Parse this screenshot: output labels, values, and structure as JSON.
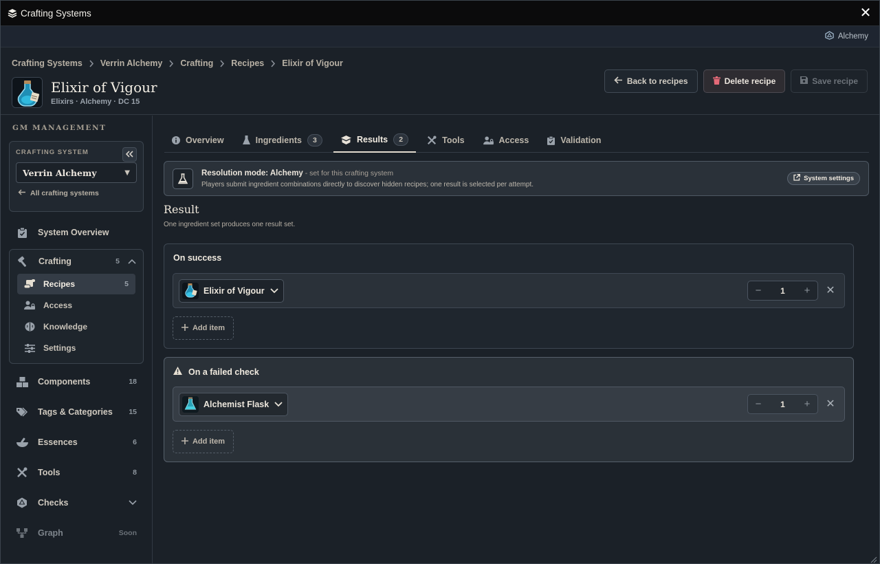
{
  "window": {
    "title": "Crafting Systems"
  },
  "sysbar": {
    "system_name": "Alchemy"
  },
  "breadcrumb": [
    "Crafting Systems",
    "Verrin Alchemy",
    "Crafting",
    "Recipes",
    "Elixir of Vigour"
  ],
  "recipe": {
    "title": "Elixir of Vigour",
    "meta": "Elixirs · Alchemy · DC 15"
  },
  "actions": {
    "back": "Back to recipes",
    "delete": "Delete recipe",
    "save": "Save recipe"
  },
  "sidebar": {
    "heading": "GM MANAGEMENT",
    "system_label": "CRAFTING SYSTEM",
    "system_selected": "Verrin Alchemy",
    "all_systems": "All crafting systems",
    "overview": "System Overview",
    "crafting": {
      "label": "Crafting",
      "count": "5"
    },
    "sub_items": [
      {
        "label": "Recipes",
        "count": "5"
      },
      {
        "label": "Access",
        "count": ""
      },
      {
        "label": "Knowledge",
        "count": ""
      },
      {
        "label": "Settings",
        "count": ""
      }
    ],
    "items": [
      {
        "label": "Components",
        "count": "18"
      },
      {
        "label": "Tags & Categories",
        "count": "15"
      },
      {
        "label": "Essences",
        "count": "6"
      },
      {
        "label": "Tools",
        "count": "8"
      },
      {
        "label": "Checks",
        "count": ""
      },
      {
        "label": "Graph",
        "count": "Soon"
      }
    ]
  },
  "tabs": [
    {
      "label": "Overview",
      "badge": ""
    },
    {
      "label": "Ingredients",
      "badge": "3"
    },
    {
      "label": "Results",
      "badge": "2"
    },
    {
      "label": "Tools",
      "badge": ""
    },
    {
      "label": "Access",
      "badge": ""
    },
    {
      "label": "Validation",
      "badge": ""
    }
  ],
  "resolution": {
    "title": "Resolution mode: Alchemy",
    "suffix": " - set for this crafting system",
    "description": "Players submit ingredient combinations directly to discover hidden recipes; one result is selected per attempt.",
    "button": "System settings"
  },
  "result": {
    "title": "Result",
    "subtitle": "One ingredient set produces one result set.",
    "success": {
      "title": "On success",
      "item": "Elixir of Vigour",
      "qty": "1",
      "add": "Add item"
    },
    "failure": {
      "title": "On a failed check",
      "item": "Alchemist Flask",
      "qty": "1",
      "add": "Add item"
    }
  },
  "colors": {
    "background": "#1b2128",
    "titlebar": "#0b0b0c",
    "accent_text": "#f1ebe1",
    "potion_blue": "#2ea7c9"
  }
}
